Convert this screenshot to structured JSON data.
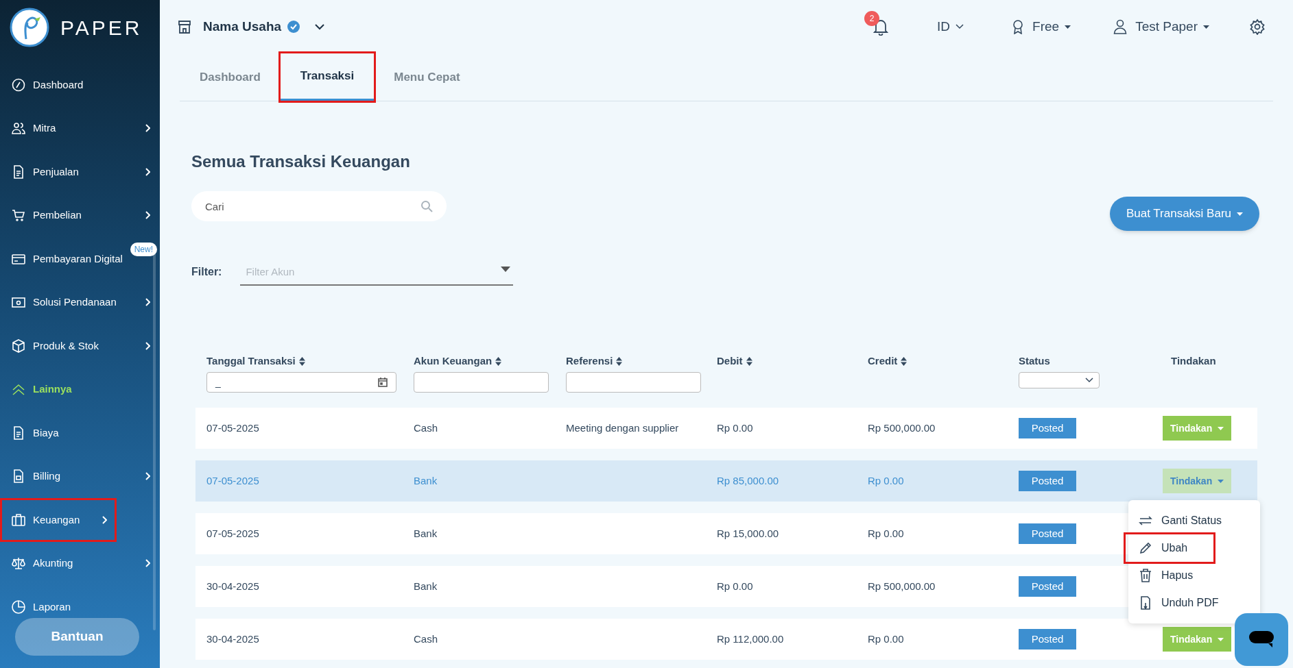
{
  "brand": {
    "name": "PAPER"
  },
  "sidebar": {
    "items": [
      {
        "label": "Dashboard",
        "submenu": false,
        "selected": false,
        "highlighted": false
      },
      {
        "label": "Mitra",
        "submenu": true,
        "selected": false,
        "highlighted": false
      },
      {
        "label": "Penjualan",
        "submenu": true,
        "selected": false,
        "highlighted": false
      },
      {
        "label": "Pembelian",
        "submenu": true,
        "selected": false,
        "highlighted": false
      },
      {
        "label": "Pembayaran Digital",
        "submenu": false,
        "badge": "New!",
        "selected": false,
        "highlighted": false
      },
      {
        "label": "Solusi Pendanaan",
        "submenu": true,
        "selected": false,
        "highlighted": false
      },
      {
        "label": "Produk & Stok",
        "submenu": true,
        "selected": false,
        "highlighted": false
      },
      {
        "label": "Lainnya",
        "submenu": false,
        "selected": true,
        "highlighted": false
      },
      {
        "label": "Biaya",
        "submenu": false,
        "selected": false,
        "highlighted": false
      },
      {
        "label": "Billing",
        "submenu": true,
        "selected": false,
        "highlighted": false
      },
      {
        "label": "Keuangan",
        "submenu": true,
        "selected": false,
        "highlighted": true
      },
      {
        "label": "Akunting",
        "submenu": true,
        "selected": false,
        "highlighted": false
      },
      {
        "label": "Laporan",
        "submenu": false,
        "selected": false,
        "highlighted": false
      }
    ],
    "help_button": "Bantuan"
  },
  "header": {
    "business": "Nama Usaha",
    "notifications": "2",
    "language": "ID",
    "plan": "Free",
    "user": "Test Paper"
  },
  "tabs": [
    {
      "label": "Dashboard",
      "selected": false,
      "highlighted": false
    },
    {
      "label": "Transaksi",
      "selected": true,
      "highlighted": true
    },
    {
      "label": "Menu Cepat",
      "selected": false,
      "highlighted": false
    }
  ],
  "page_title": "Semua Transaksi Keuangan",
  "search": {
    "placeholder": "Cari"
  },
  "new_button": "Buat Transaksi Baru",
  "filter": {
    "label": "Filter:",
    "placeholder": "Filter Akun"
  },
  "table": {
    "columns": [
      {
        "label": "Tanggal Transaksi",
        "sortable": true,
        "kind": "date",
        "value": "_"
      },
      {
        "label": "Akun Keuangan",
        "sortable": true,
        "kind": "text"
      },
      {
        "label": "Referensi",
        "sortable": true,
        "kind": "text"
      },
      {
        "label": "Debit",
        "sortable": true,
        "kind": "plain"
      },
      {
        "label": "Credit",
        "sortable": true,
        "kind": "plain"
      },
      {
        "label": "Status",
        "sortable": false,
        "kind": "select"
      },
      {
        "label": "Tindakan",
        "sortable": false,
        "kind": "plain"
      }
    ],
    "rows": [
      {
        "date": "07-05-2025",
        "account": "Cash",
        "reference": "Meeting dengan supplier",
        "debit": "Rp 0.00",
        "credit": "Rp 500,000.00",
        "status": "Posted",
        "action": "Tindakan",
        "selected": false
      },
      {
        "date": "07-05-2025",
        "account": "Bank",
        "debit": "Rp 85,000.00",
        "credit": "Rp 0.00",
        "status": "Posted",
        "action": "Tindakan",
        "selected": true
      },
      {
        "date": "07-05-2025",
        "account": "Bank",
        "debit": "Rp 15,000.00",
        "credit": "Rp 0.00",
        "status": "Posted",
        "selected": false
      },
      {
        "date": "30-04-2025",
        "account": "Bank",
        "debit": "Rp 0.00",
        "credit": "Rp 500,000.00",
        "status": "Posted",
        "selected": false
      },
      {
        "date": "30-04-2025",
        "account": "Cash",
        "debit": "Rp 112,000.00",
        "credit": "Rp 0.00",
        "status": "Posted",
        "action": "Tindakan",
        "selected": false
      }
    ]
  },
  "action_menu": {
    "items": [
      {
        "label": "Ganti Status",
        "highlighted": false
      },
      {
        "label": "Ubah",
        "highlighted": true
      },
      {
        "label": "Hapus",
        "highlighted": false
      },
      {
        "label": "Unduh PDF",
        "highlighted": false
      }
    ]
  }
}
